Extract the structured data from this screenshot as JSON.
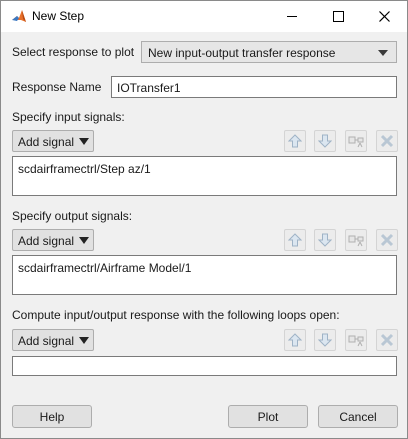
{
  "window": {
    "title": "New Step"
  },
  "response_select": {
    "label": "Select response to plot",
    "value": "New input-output transfer response"
  },
  "response_name": {
    "label": "Response Name",
    "value": "IOTransfer1"
  },
  "input_section": {
    "label": "Specify input signals:",
    "add_label": "Add signal",
    "items": [
      "scdairframectrl/Step az/1"
    ]
  },
  "output_section": {
    "label": "Specify output signals:",
    "add_label": "Add signal",
    "items": [
      "scdairframectrl/Airframe Model/1"
    ]
  },
  "loops_section": {
    "label": "Compute input/output response with the following loops open:",
    "add_label": "Add signal",
    "items": []
  },
  "buttons": {
    "help": "Help",
    "plot": "Plot",
    "cancel": "Cancel"
  },
  "icons": [
    "matlab-icon",
    "move-up-icon",
    "move-down-icon",
    "highlight-icon",
    "delete-icon"
  ]
}
